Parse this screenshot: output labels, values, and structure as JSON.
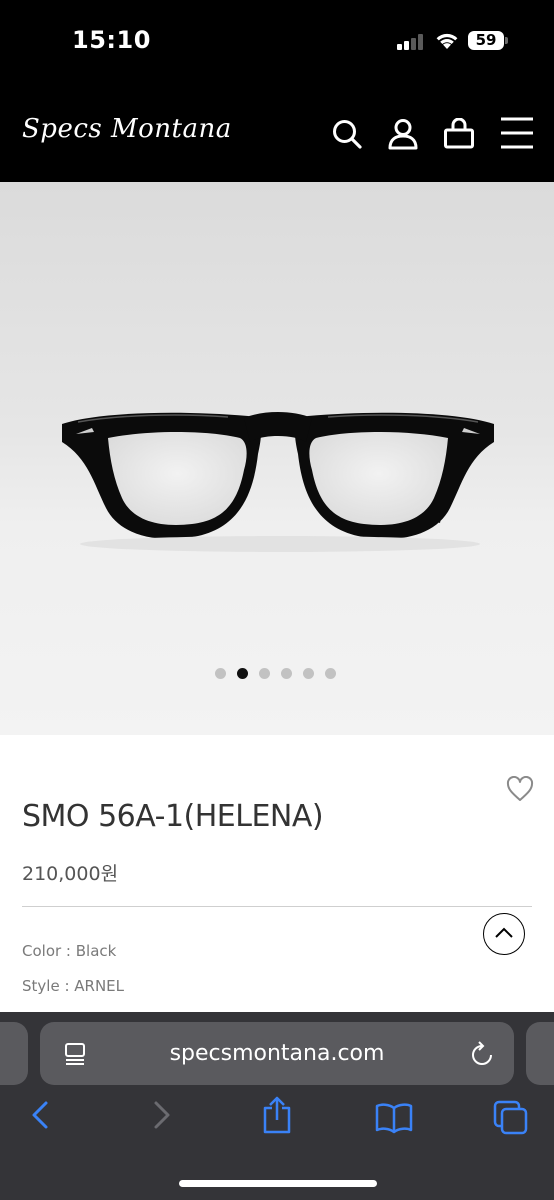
{
  "status_bar": {
    "time": "15:10",
    "battery": "59"
  },
  "header": {
    "logo": "Specs Montana"
  },
  "gallery": {
    "total_images": 6,
    "active_index": 1
  },
  "product": {
    "name": "SMO 56A-1(HELENA)",
    "price": "210,000원",
    "color_option": "Color : Black",
    "style_option": "Style : ARNEL"
  },
  "browser": {
    "url": "specsmontana.com"
  },
  "colors": {
    "accent_blue": "#3a82f7",
    "header_bg": "#000000",
    "safari_bg": "#343438"
  }
}
